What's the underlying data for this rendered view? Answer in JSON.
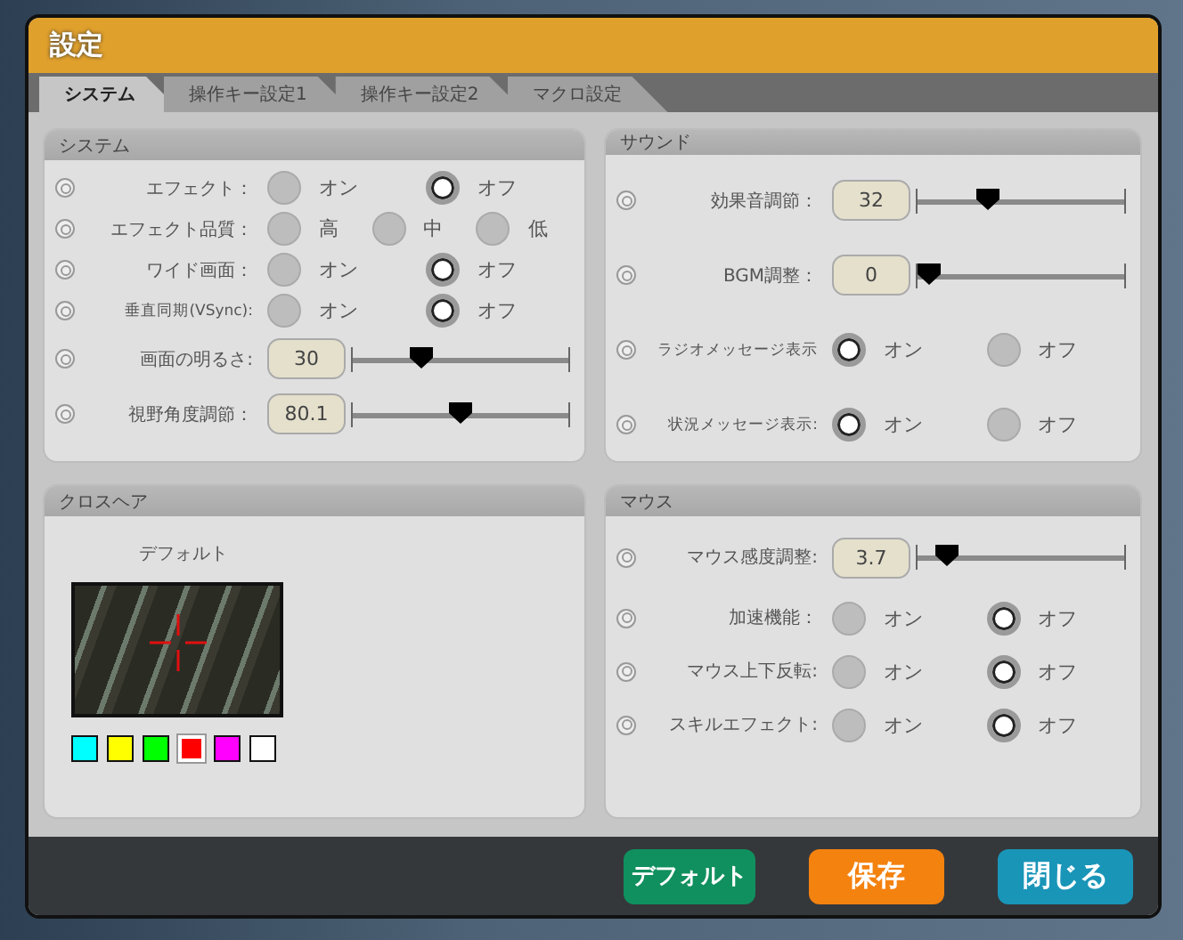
{
  "window": {
    "title": "設定"
  },
  "tabs": [
    {
      "label": "システム",
      "selected": true
    },
    {
      "label": "操作キー設定1",
      "selected": false
    },
    {
      "label": "操作キー設定2",
      "selected": false
    },
    {
      "label": "マクロ設定",
      "selected": false
    }
  ],
  "system": {
    "title": "システム",
    "rows": [
      {
        "kind": "radio",
        "label": "エフェクト：",
        "options": [
          {
            "label": "オン",
            "selected": false
          },
          {
            "label": "オフ",
            "selected": true
          }
        ]
      },
      {
        "kind": "radio",
        "label": "エフェクト品質：",
        "options": [
          {
            "label": "高",
            "selected": false
          },
          {
            "label": "中",
            "selected": false
          },
          {
            "label": "低",
            "selected": false
          }
        ]
      },
      {
        "kind": "radio",
        "label": "ワイド画面：",
        "options": [
          {
            "label": "オン",
            "selected": false
          },
          {
            "label": "オフ",
            "selected": true
          }
        ]
      },
      {
        "kind": "radio",
        "label": "垂直同期(VSync):",
        "options": [
          {
            "label": "オン",
            "selected": false
          },
          {
            "label": "オフ",
            "selected": true
          }
        ]
      },
      {
        "kind": "slider",
        "label": "画面の明るさ:",
        "value": "30",
        "level": 0.3
      },
      {
        "kind": "slider",
        "label": "視野角度調節：",
        "value": "80.1",
        "level": 0.5
      }
    ]
  },
  "sound": {
    "title": "サウンド",
    "rows": [
      {
        "kind": "slider",
        "label": "効果音調節：",
        "value": "32",
        "level": 0.32
      },
      {
        "kind": "slider",
        "label": "BGM調整：",
        "value": "0",
        "level": 0
      },
      {
        "kind": "radio",
        "label": "ラジオメッセージ表示",
        "options": [
          {
            "label": "オン",
            "selected": true
          },
          {
            "label": "オフ",
            "selected": false
          }
        ]
      },
      {
        "kind": "radio",
        "label": "状況メッセージ表示:",
        "options": [
          {
            "label": "オン",
            "selected": true
          },
          {
            "label": "オフ",
            "selected": false
          }
        ]
      }
    ]
  },
  "crosshair": {
    "title": "クロスヘア",
    "preset": "デフォルト",
    "colors": [
      {
        "color": "#00ffff",
        "selected": false
      },
      {
        "color": "#ffff00",
        "selected": false
      },
      {
        "color": "#00ff00",
        "selected": false
      },
      {
        "color": "#ff0000",
        "selected": true
      },
      {
        "color": "#ff00ff",
        "selected": false
      },
      {
        "color": "#ffffff",
        "selected": false
      }
    ]
  },
  "mouse": {
    "title": "マウス",
    "rows": [
      {
        "kind": "slider",
        "label": "マウス感度調整:",
        "value": "3.7",
        "level": 0.1
      },
      {
        "kind": "radio",
        "label": "加速機能：",
        "options": [
          {
            "label": "オン",
            "selected": false
          },
          {
            "label": "オフ",
            "selected": true
          }
        ]
      },
      {
        "kind": "radio",
        "label": "マウス上下反転:",
        "options": [
          {
            "label": "オン",
            "selected": false
          },
          {
            "label": "オフ",
            "selected": true
          }
        ]
      },
      {
        "kind": "radio",
        "label": "スキルエフェクト:",
        "options": [
          {
            "label": "オン",
            "selected": false
          },
          {
            "label": "オフ",
            "selected": true
          }
        ]
      }
    ]
  },
  "buttons": [
    {
      "label": "デフォルト",
      "kind": "default"
    },
    {
      "label": "保存",
      "kind": "save"
    },
    {
      "label": "閉じる",
      "kind": "close"
    }
  ]
}
